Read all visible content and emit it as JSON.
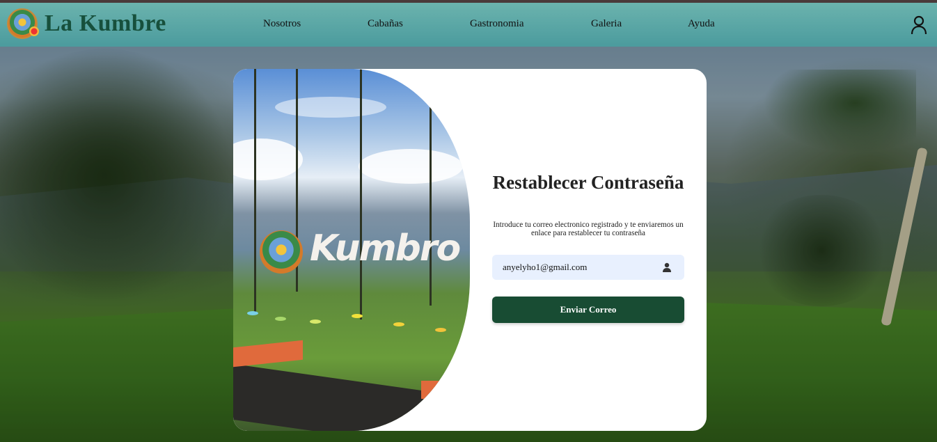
{
  "brand": {
    "name": "La Kumbre",
    "logo_icon": "la-kumbre-logo"
  },
  "nav": {
    "items": [
      {
        "label": "Nosotros"
      },
      {
        "label": "Cabañas"
      },
      {
        "label": "Gastronomia"
      },
      {
        "label": "Galeria"
      },
      {
        "label": "Ayuda"
      }
    ],
    "account_icon": "user-icon"
  },
  "card": {
    "photo_sign_text": "Kumbro",
    "title": "Restablecer Contraseña",
    "description": "Introduce tu correo electronico registrado y te enviaremos un enlace para restablecer tu contraseña",
    "email": {
      "value": "anyelyho1@gmail.com",
      "icon": "person-icon"
    },
    "submit_label": "Enviar Correo"
  },
  "colors": {
    "navbar": "#6ebeb4",
    "brand_text": "#17503c",
    "button": "#184c33",
    "input_bg": "#e8f0fe"
  }
}
